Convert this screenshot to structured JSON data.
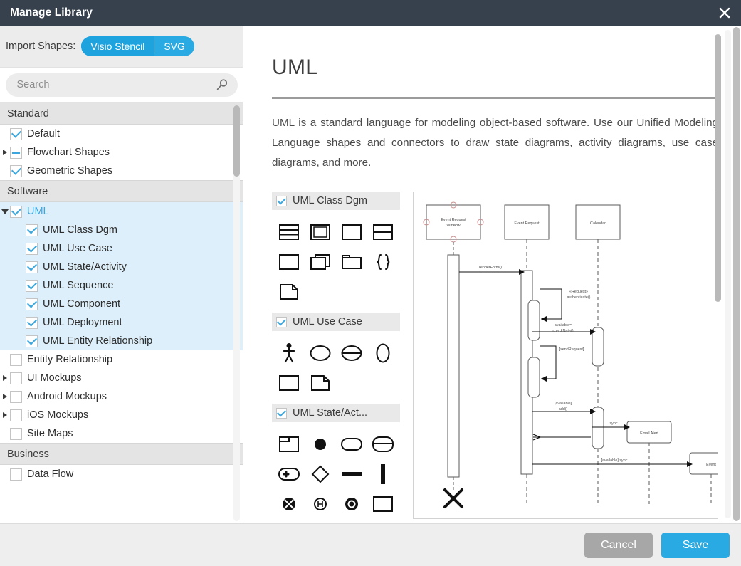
{
  "window": {
    "title": "Manage Library",
    "close_icon": "close-icon"
  },
  "sidebar": {
    "import_label": "Import Shapes:",
    "import_options": [
      "Visio Stencil",
      "SVG"
    ],
    "search": {
      "value": "",
      "placeholder": "Search",
      "icon": "search-icon"
    },
    "groups": [
      {
        "name": "Standard",
        "items": [
          {
            "label": "Default",
            "state": "checked",
            "indent": 1,
            "expandable": false,
            "selected": false
          },
          {
            "label": "Flowchart Shapes",
            "state": "indeterminate",
            "indent": 1,
            "expandable": true,
            "selected": false
          },
          {
            "label": "Geometric Shapes",
            "state": "checked",
            "indent": 1,
            "expandable": false,
            "selected": false
          }
        ]
      },
      {
        "name": "Software",
        "items": [
          {
            "label": "UML",
            "state": "checked",
            "indent": 1,
            "expandable": true,
            "expanded": true,
            "selected": true,
            "parent": true
          },
          {
            "label": "UML Class Dgm",
            "state": "checked",
            "indent": 2,
            "expandable": false,
            "selected": true
          },
          {
            "label": "UML Use Case",
            "state": "checked",
            "indent": 2,
            "expandable": false,
            "selected": true
          },
          {
            "label": "UML State/Activity",
            "state": "checked",
            "indent": 2,
            "expandable": false,
            "selected": true
          },
          {
            "label": "UML Sequence",
            "state": "checked",
            "indent": 2,
            "expandable": false,
            "selected": true
          },
          {
            "label": "UML Component",
            "state": "checked",
            "indent": 2,
            "expandable": false,
            "selected": true
          },
          {
            "label": "UML Deployment",
            "state": "checked",
            "indent": 2,
            "expandable": false,
            "selected": true
          },
          {
            "label": "UML Entity Relationship",
            "state": "checked",
            "indent": 2,
            "expandable": false,
            "selected": true
          },
          {
            "label": "Entity Relationship",
            "state": "unchecked",
            "indent": 1,
            "expandable": false,
            "selected": false
          },
          {
            "label": "UI Mockups",
            "state": "unchecked",
            "indent": 1,
            "expandable": true,
            "selected": false
          },
          {
            "label": "Android Mockups",
            "state": "unchecked",
            "indent": 1,
            "expandable": true,
            "selected": false
          },
          {
            "label": "iOS Mockups",
            "state": "unchecked",
            "indent": 1,
            "expandable": true,
            "selected": false
          },
          {
            "label": "Site Maps",
            "state": "unchecked",
            "indent": 1,
            "expandable": false,
            "selected": false
          }
        ]
      },
      {
        "name": "Business",
        "items": [
          {
            "label": "Data Flow",
            "state": "unchecked",
            "indent": 1,
            "expandable": false,
            "selected": false
          }
        ]
      }
    ]
  },
  "detail": {
    "title": "UML",
    "description": "UML is a standard language for modeling object-based software. Use our Unified Modeling Language shapes and connectors to draw state diagrams, activity diagrams, use case diagrams, and more.",
    "categories": [
      {
        "label": "UML Class Dgm",
        "state": "checked"
      },
      {
        "label": "UML Use Case",
        "state": "checked"
      },
      {
        "label": "UML State/Act...",
        "state": "checked"
      }
    ],
    "preview": {
      "name": "uml-sequence-diagram-preview",
      "lifelines": [
        "Event Request Window",
        "Event Request",
        "Calendar",
        "Email Alert",
        "Event"
      ],
      "messages": [
        "renderForm()",
        "«Request» authenticate()",
        "[sendRequest]",
        "available= checkDate()",
        "[available] add()",
        "sync",
        "[available] sync"
      ]
    }
  },
  "footer": {
    "cancel_label": "Cancel",
    "save_label": "Save"
  },
  "colors": {
    "titlebar": "#37404d",
    "accent": "#29aae2",
    "selection": "#ddeffa",
    "cancel": "#a7a7a7"
  }
}
